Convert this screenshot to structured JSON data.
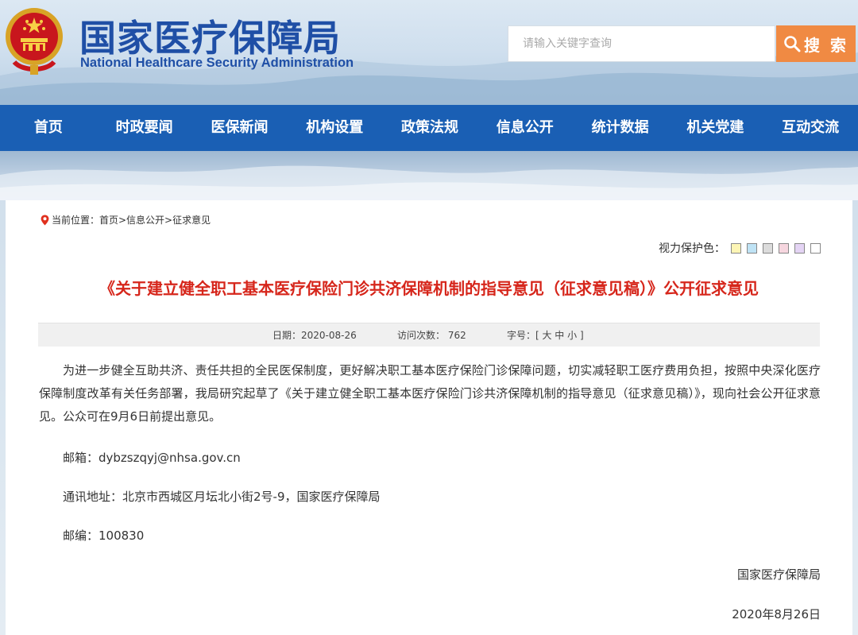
{
  "header": {
    "title": "国家医疗保障局",
    "subtitle": "National Healthcare Security Administration",
    "search_placeholder": "请输入关键字查询",
    "search_button": "搜 索"
  },
  "nav": {
    "items": [
      "首页",
      "时政要闻",
      "医保新闻",
      "机构设置",
      "政策法规",
      "信息公开",
      "统计数据",
      "机关党建",
      "互动交流"
    ]
  },
  "breadcrumb": {
    "text": "当前位置：首页>信息公开>征求意见"
  },
  "vision": {
    "label": "视力保护色：",
    "colors": [
      "#fdf5b5",
      "#bfe3f5",
      "#dcdcdc",
      "#f6d6df",
      "#e4d4f4",
      "#ffffff"
    ]
  },
  "article": {
    "title": "《关于建立健全职工基本医疗保险门诊共济保障机制的指导意见（征求意见稿）》公开征求意见",
    "date": "日期：2020-08-26",
    "visits": "访问次数： 762",
    "font_size": "字号：[ 大 中 小 ]",
    "paragraph": "为进一步健全互助共济、责任共担的全民医保制度，更好解决职工基本医疗保险门诊保障问题，切实减轻职工医疗费用负担，按照中央深化医疗保障制度改革有关任务部署，我局研究起草了《关于建立健全职工基本医疗保险门诊共济保障机制的指导意见（征求意见稿）》，现向社会公开征求意见。公众可在9月6日前提出意见。",
    "email": "邮箱：dybzszqyj@nhsa.gov.cn",
    "address": "通讯地址：北京市西城区月坛北小街2号-9，国家医疗保障局",
    "postcode": "邮编：100830",
    "signature": "国家医疗保障局",
    "sign_date": "2020年8月26日"
  },
  "colors": {
    "nav_bg": "#1a5fb4",
    "title_red": "#d6261b",
    "search_orange": "#f08a43",
    "brand_blue": "#1f4fa6"
  }
}
